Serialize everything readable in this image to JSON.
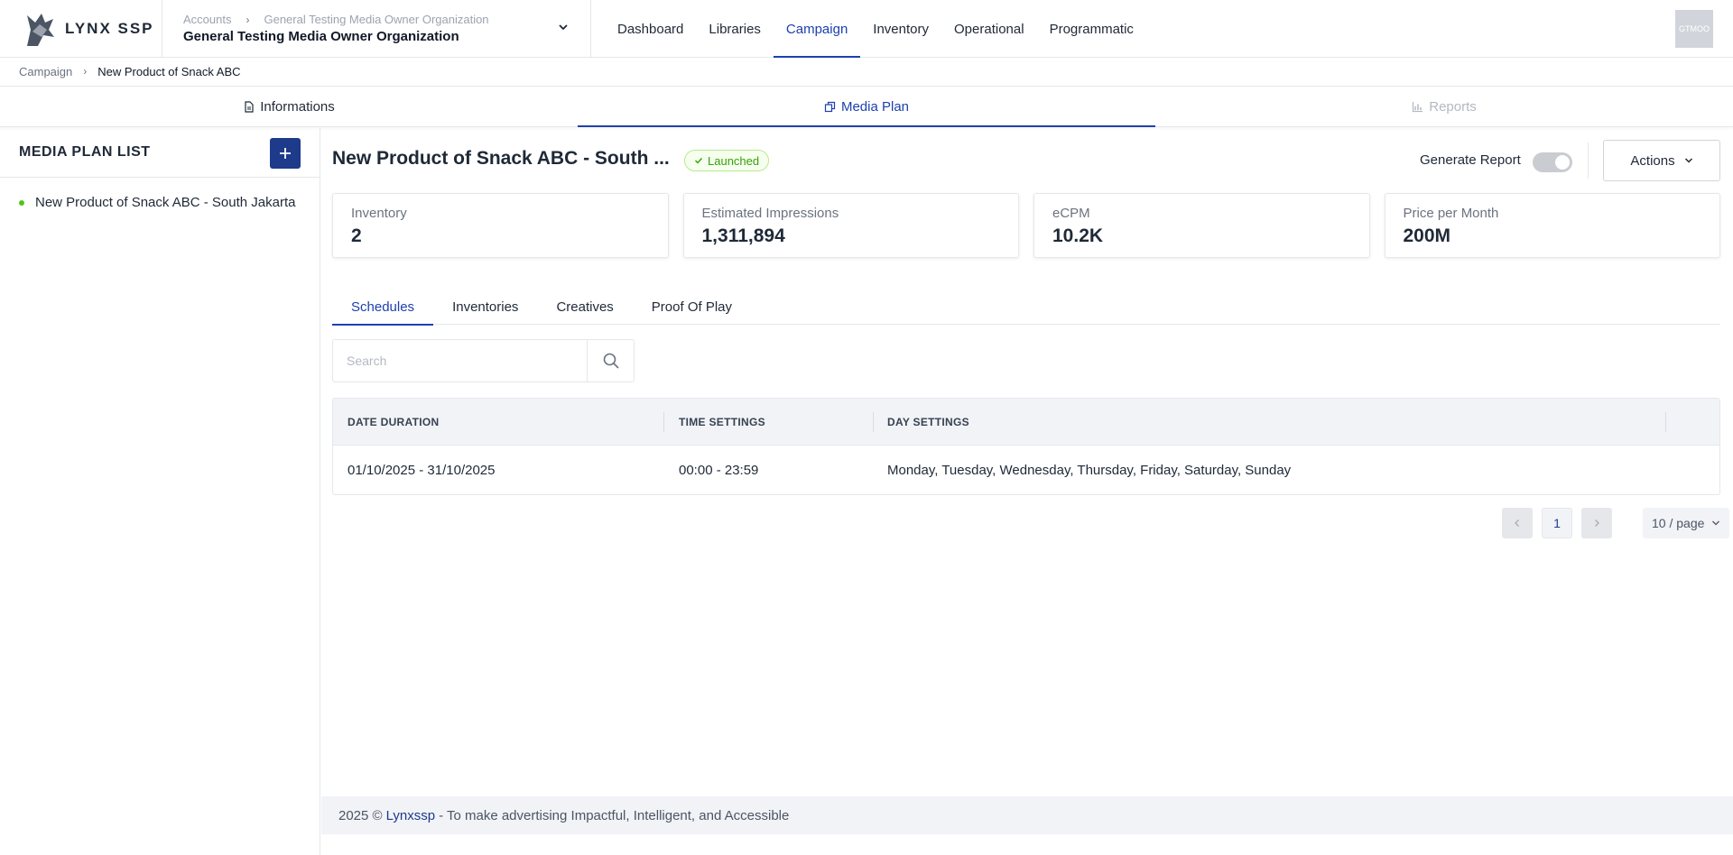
{
  "app": {
    "logo_text": "LYNX SSP"
  },
  "header": {
    "org_breadcrumb": [
      "Accounts",
      "General Testing Media Owner Organization"
    ],
    "org_name": "General Testing Media Owner Organization",
    "nav": [
      "Dashboard",
      "Libraries",
      "Campaign",
      "Inventory",
      "Operational",
      "Programmatic"
    ],
    "nav_active": "Campaign",
    "avatar_text": "GTMOO"
  },
  "breadcrumb": {
    "parent": "Campaign",
    "current": "New Product of Snack ABC"
  },
  "top_tabs": [
    {
      "label": "Informations",
      "state": "normal"
    },
    {
      "label": "Media Plan",
      "state": "active"
    },
    {
      "label": "Reports",
      "state": "disabled"
    }
  ],
  "sidebar": {
    "title": "MEDIA PLAN LIST",
    "items": [
      {
        "label": "New Product of Snack ABC - South Jakarta",
        "status_color": "#52c41a"
      }
    ]
  },
  "plan": {
    "title": "New Product of Snack ABC - South ...",
    "status": "Launched",
    "generate_report_label": "Generate Report",
    "generate_report_on": false,
    "actions_label": "Actions"
  },
  "stats": [
    {
      "label": "Inventory",
      "value": "2"
    },
    {
      "label": "Estimated Impressions",
      "value": "1,311,894"
    },
    {
      "label": "eCPM",
      "value": "10.2K"
    },
    {
      "label": "Price per Month",
      "value": "200M"
    }
  ],
  "sub_tabs": [
    "Schedules",
    "Inventories",
    "Creatives",
    "Proof Of Play"
  ],
  "search": {
    "placeholder": "Search",
    "value": ""
  },
  "table": {
    "columns": [
      "DATE DURATION",
      "TIME SETTINGS",
      "DAY SETTINGS"
    ],
    "rows": [
      [
        "01/10/2025 - 31/10/2025",
        "00:00 - 23:59",
        "Monday, Tuesday, Wednesday, Thursday, Friday, Saturday, Sunday"
      ]
    ]
  },
  "pagination": {
    "current_page": "1",
    "page_size": "10 / page"
  },
  "footer": {
    "prefix": "2025 ©",
    "brand": "Lynxssp",
    "suffix": "- To make advertising Impactful, Intelligent, and Accessible"
  },
  "colors": {
    "primary": "#1e3a8a",
    "accent": "#1e40af",
    "success": "#52c41a"
  }
}
